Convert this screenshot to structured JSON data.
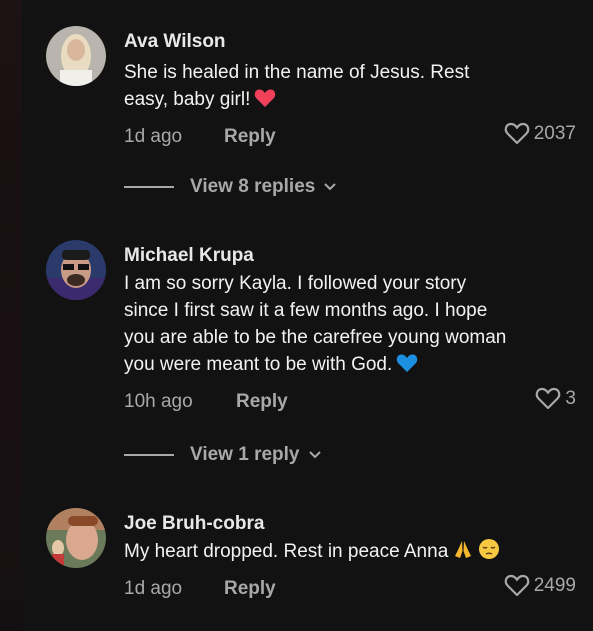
{
  "comments": [
    {
      "author": "Ava Wilson",
      "text_lines": [
        "She is healed in the name of Jesus. Rest",
        "easy, baby girl!"
      ],
      "emoji": "heart-red",
      "time": "1d ago",
      "reply_label": "Reply",
      "likes": "2037"
    },
    {
      "author": "Michael Krupa",
      "text_lines": [
        "I am so sorry Kayla. I followed your story",
        "since I first saw it a few months ago. I hope",
        "you are able to be the carefree young woman",
        "you were meant to be with God."
      ],
      "emoji": "heart-blue",
      "time": "10h ago",
      "reply_label": "Reply",
      "likes": "3"
    },
    {
      "author": "Joe Bruh-cobra",
      "text_lines": [
        "My heart dropped. Rest in peace Anna"
      ],
      "emoji": "folded-hands, pensive-face",
      "time": "1d ago",
      "reply_label": "Reply",
      "likes": "2499"
    }
  ],
  "view_replies": [
    "View 8 replies",
    "View 1 reply"
  ],
  "colors": {
    "background": "#121212",
    "text": "#f2f2f2",
    "muted": "#a8a8a8",
    "red_heart": "#f0405a",
    "blue_heart": "#1d8fe0"
  }
}
